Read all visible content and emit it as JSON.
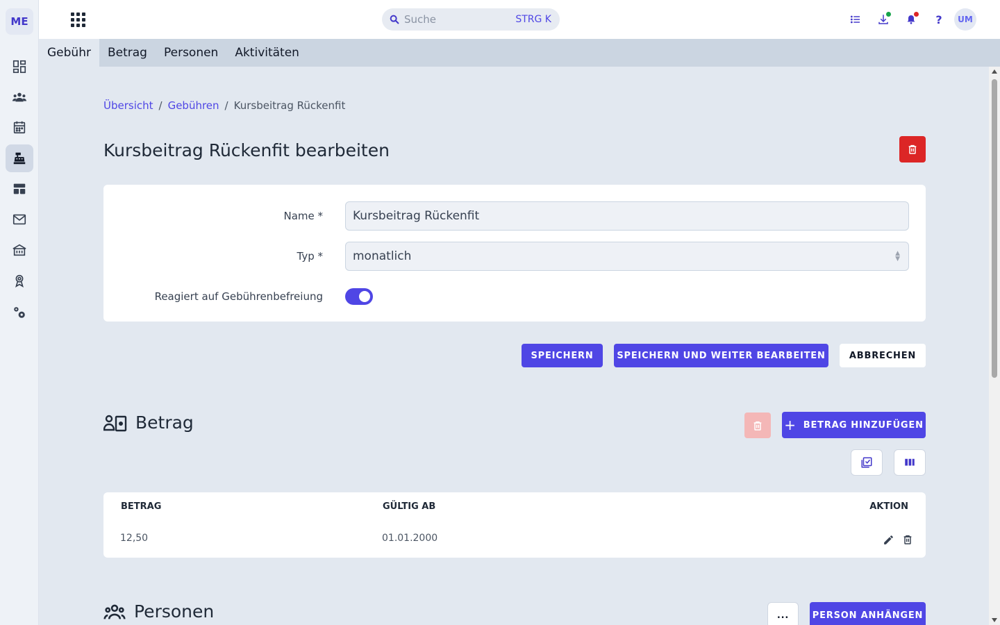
{
  "sidebar": {
    "logo": "ME",
    "items": [
      {
        "name": "dashboard-icon"
      },
      {
        "name": "people-icon"
      },
      {
        "name": "calendar-icon"
      },
      {
        "name": "cash-register-icon",
        "active": true
      },
      {
        "name": "table-icon"
      },
      {
        "name": "mail-icon"
      },
      {
        "name": "building-icon"
      },
      {
        "name": "award-icon"
      },
      {
        "name": "settings-icon"
      }
    ]
  },
  "topbar": {
    "search_placeholder": "Suche",
    "search_shortcut": "STRG K",
    "help": "?",
    "avatar": "UM",
    "notification_dot_color": "#dc2626",
    "download_dot_color": "#16a34a"
  },
  "tabs": [
    {
      "label": "Gebühr",
      "active": true
    },
    {
      "label": "Betrag"
    },
    {
      "label": "Personen"
    },
    {
      "label": "Aktivitäten"
    }
  ],
  "breadcrumb": {
    "items": [
      "Übersicht",
      "Gebühren"
    ],
    "separator": "/",
    "current": "Kursbeitrag Rückenfit"
  },
  "page_title": "Kursbeitrag Rückenfit bearbeiten",
  "form": {
    "name_label": "Name *",
    "name_value": "Kursbeitrag Rückenfit",
    "type_label": "Typ *",
    "type_value": "monatlich",
    "exemption_label": "Reagiert auf Gebührenbefreiung",
    "exemption_enabled": true
  },
  "actions": {
    "save": "SPEICHERN",
    "save_continue": "SPEICHERN UND WEITER BEARBEITEN",
    "cancel": "ABBRECHEN"
  },
  "betrag_section": {
    "title": "Betrag",
    "add_button": "BETRAG HINZUFÜGEN",
    "add_icon": "+",
    "columns": [
      "BETRAG",
      "GÜLTIG AB",
      "AKTION"
    ],
    "rows": [
      {
        "betrag": "12,50",
        "gueltig_ab": "01.01.2000"
      }
    ]
  },
  "personen_section": {
    "title": "Personen",
    "more_button": "...",
    "attach_button": "PERSON ANHÄNGEN"
  },
  "colors": {
    "primary": "#4f46e5",
    "danger": "#dc2626",
    "background": "#e2e8f0"
  }
}
